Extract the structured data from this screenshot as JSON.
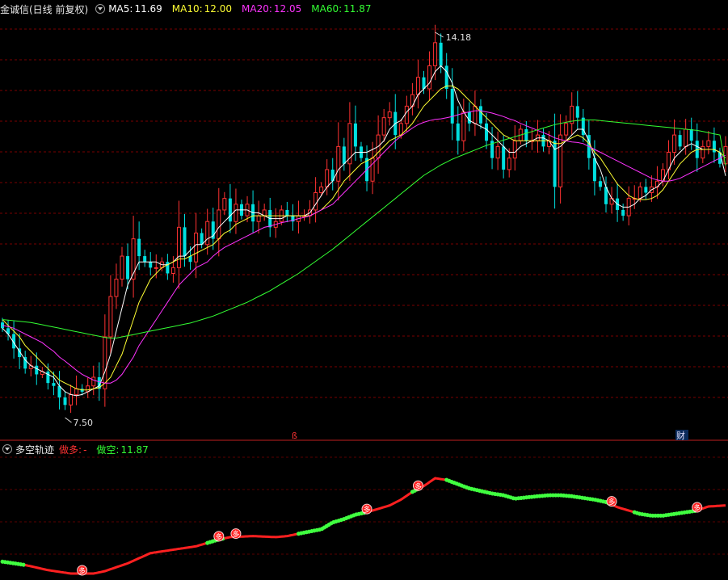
{
  "header": {
    "stock_title": "金诚信(日线 前复权)",
    "ma_legend": [
      {
        "label": "MA5:",
        "value": "11.69",
        "color": "#ffffff"
      },
      {
        "label": "MA10:",
        "value": "12.00",
        "color": "#ffff33"
      },
      {
        "label": "MA20:",
        "value": "12.05",
        "color": "#ff33ff"
      },
      {
        "label": "MA60:",
        "value": "11.87",
        "color": "#33ff33"
      }
    ]
  },
  "sub_header": {
    "title": "多空轨迹",
    "long_label": "做多:",
    "long_value": "-",
    "short_label": "做空:",
    "short_value": "11.87"
  },
  "markers": {
    "date_marker": "ß",
    "finance_marker": "财",
    "signal_label": "多"
  },
  "colors": {
    "background": "#000000",
    "grid": "#7a0000",
    "up": "#ff3232",
    "down": "#00e0e0",
    "ma5": "#ffffff",
    "ma10": "#ffff33",
    "ma20": "#ff33ff",
    "ma60": "#33ff33",
    "trend_long": "#ff2020",
    "trend_short": "#40ff40"
  },
  "chart_data": [
    {
      "type": "candlestick",
      "ylim": [
        7.2,
        14.7
      ],
      "max_label": "14.18",
      "min_label": "7.50",
      "max_point": [
        76,
        14.18
      ],
      "min_point": [
        11,
        7.5
      ],
      "close": [
        9.05,
        8.95,
        8.7,
        8.55,
        8.35,
        8.4,
        8.25,
        8.3,
        8.1,
        8.05,
        7.85,
        7.72,
        7.9,
        8.0,
        7.95,
        8.05,
        8.2,
        8.0,
        8.9,
        9.6,
        9.9,
        10.3,
        9.9,
        10.6,
        10.3,
        10.2,
        10.1,
        10.1,
        10.2,
        10.0,
        10.1,
        10.8,
        10.3,
        10.2,
        10.7,
        10.5,
        10.9,
        10.6,
        11.1,
        11.3,
        10.9,
        11.2,
        11.0,
        11.2,
        10.9,
        11.0,
        11.1,
        10.8,
        10.9,
        11.1,
        11.0,
        10.9,
        11.0,
        11.0,
        11.1,
        11.4,
        11.5,
        11.8,
        11.6,
        12.2,
        11.9,
        12.6,
        12.2,
        12.0,
        11.6,
        12.0,
        12.4,
        12.7,
        12.8,
        12.4,
        12.6,
        12.9,
        13.1,
        13.4,
        13.2,
        13.6,
        14.0,
        13.6,
        13.2,
        12.6,
        12.3,
        12.8,
        12.6,
        12.9,
        12.6,
        12.3,
        12.0,
        12.2,
        11.8,
        12.0,
        12.3,
        12.5,
        12.3,
        12.3,
        12.4,
        12.2,
        12.3,
        11.5,
        12.4,
        12.6,
        12.9,
        12.7,
        12.4,
        12.0,
        11.6,
        11.5,
        11.2,
        11.3,
        11.1,
        11.0,
        11.3,
        11.3,
        11.5,
        11.4,
        11.5,
        11.6,
        11.8,
        12.1,
        12.4,
        12.2,
        12.5,
        12.3,
        12.0,
        12.2,
        12.3,
        12.1,
        11.9,
        12.2
      ]
    },
    {
      "type": "line",
      "series": [
        {
          "name": "MA5",
          "values": [
            9.05,
            8.95,
            8.8,
            8.65,
            8.5,
            8.4,
            8.35,
            8.3,
            8.25,
            8.2,
            8.05,
            7.95,
            7.9,
            7.88,
            7.9,
            7.95,
            8.0,
            8.05,
            8.3,
            8.6,
            9.0,
            9.4,
            9.8,
            10.0,
            10.2,
            10.2,
            10.2,
            10.2,
            10.15,
            10.15,
            10.2,
            10.3,
            10.3,
            10.4,
            10.5,
            10.5,
            10.6,
            10.65,
            10.8,
            10.9,
            11.0,
            11.1,
            11.1,
            11.1,
            11.05,
            11.05,
            11.0,
            10.95,
            10.95,
            10.95,
            11.0,
            11.0,
            11.0,
            11.0,
            11.05,
            11.2,
            11.35,
            11.5,
            11.6,
            11.8,
            11.9,
            12.0,
            12.1,
            12.1,
            12.1,
            12.15,
            12.2,
            12.3,
            12.5,
            12.6,
            12.65,
            12.8,
            12.9,
            13.1,
            13.2,
            13.3,
            13.5,
            13.6,
            13.5,
            13.3,
            13.0,
            12.8,
            12.65,
            12.6,
            12.55,
            12.5,
            12.4,
            12.3,
            12.2,
            12.1,
            12.1,
            12.2,
            12.25,
            12.3,
            12.35,
            12.35,
            12.3,
            12.15,
            12.2,
            12.3,
            12.4,
            12.5,
            12.5,
            12.3,
            12.0,
            11.8,
            11.5,
            11.3,
            11.2,
            11.15,
            11.15,
            11.2,
            11.3,
            11.35,
            11.45,
            11.5,
            11.6,
            11.8,
            12.0,
            12.1,
            12.2,
            12.25,
            12.2,
            12.15,
            12.15,
            12.15,
            12.1,
            11.69
          ]
        },
        {
          "name": "MA10",
          "values": [
            9.2,
            9.1,
            9.0,
            8.9,
            8.75,
            8.65,
            8.55,
            8.45,
            8.35,
            8.25,
            8.15,
            8.1,
            8.05,
            8.0,
            7.98,
            7.98,
            8.0,
            8.02,
            8.1,
            8.2,
            8.4,
            8.6,
            8.9,
            9.2,
            9.5,
            9.7,
            9.9,
            10.0,
            10.1,
            10.15,
            10.2,
            10.25,
            10.25,
            10.3,
            10.35,
            10.4,
            10.45,
            10.5,
            10.6,
            10.7,
            10.75,
            10.85,
            10.9,
            10.95,
            11.0,
            11.0,
            11.0,
            11.0,
            11.0,
            11.0,
            11.0,
            11.0,
            11.0,
            11.0,
            11.0,
            11.05,
            11.1,
            11.2,
            11.3,
            11.45,
            11.6,
            11.7,
            11.8,
            11.9,
            11.95,
            12.0,
            12.1,
            12.2,
            12.3,
            12.35,
            12.4,
            12.5,
            12.6,
            12.75,
            12.9,
            13.0,
            13.1,
            13.2,
            13.25,
            13.25,
            13.2,
            13.1,
            13.0,
            12.9,
            12.8,
            12.7,
            12.6,
            12.5,
            12.4,
            12.35,
            12.3,
            12.3,
            12.3,
            12.3,
            12.3,
            12.3,
            12.3,
            12.25,
            12.25,
            12.3,
            12.35,
            12.4,
            12.35,
            12.25,
            12.1,
            12.0,
            11.85,
            11.7,
            11.55,
            11.45,
            11.35,
            11.3,
            11.28,
            11.28,
            11.3,
            11.35,
            11.45,
            11.6,
            11.75,
            11.9,
            12.0,
            12.1,
            12.15,
            12.15,
            12.15,
            12.15,
            12.1,
            12.0
          ]
        },
        {
          "name": "MA20",
          "values": [
            9.1,
            9.08,
            9.05,
            9.0,
            8.95,
            8.9,
            8.85,
            8.8,
            8.72,
            8.65,
            8.55,
            8.48,
            8.4,
            8.32,
            8.25,
            8.2,
            8.15,
            8.12,
            8.1,
            8.1,
            8.15,
            8.25,
            8.4,
            8.55,
            8.75,
            8.9,
            9.05,
            9.2,
            9.35,
            9.5,
            9.65,
            9.8,
            9.9,
            10.0,
            10.1,
            10.15,
            10.2,
            10.3,
            10.38,
            10.45,
            10.5,
            10.55,
            10.6,
            10.65,
            10.7,
            10.75,
            10.8,
            10.82,
            10.85,
            10.88,
            10.9,
            10.92,
            10.95,
            10.97,
            11.0,
            11.05,
            11.1,
            11.15,
            11.2,
            11.3,
            11.4,
            11.5,
            11.6,
            11.7,
            11.8,
            11.9,
            12.0,
            12.1,
            12.2,
            12.3,
            12.38,
            12.45,
            12.52,
            12.58,
            12.62,
            12.65,
            12.67,
            12.68,
            12.7,
            12.72,
            12.75,
            12.78,
            12.8,
            12.82,
            12.82,
            12.8,
            12.78,
            12.75,
            12.72,
            12.68,
            12.65,
            12.6,
            12.56,
            12.52,
            12.48,
            12.44,
            12.4,
            12.35,
            12.32,
            12.3,
            12.28,
            12.27,
            12.25,
            12.2,
            12.15,
            12.1,
            12.05,
            12.0,
            11.95,
            11.9,
            11.85,
            11.8,
            11.75,
            11.7,
            11.65,
            11.62,
            11.6,
            11.6,
            11.62,
            11.65,
            11.7,
            11.75,
            11.8,
            11.85,
            11.9,
            11.95,
            12.0,
            12.05
          ]
        },
        {
          "name": "MA60",
          "values": [
            9.2,
            9.19,
            9.18,
            9.17,
            9.16,
            9.15,
            9.13,
            9.11,
            9.09,
            9.07,
            9.05,
            9.03,
            9.01,
            8.99,
            8.97,
            8.95,
            8.93,
            8.91,
            8.89,
            8.88,
            8.88,
            8.9,
            8.92,
            8.94,
            8.96,
            8.98,
            9.0,
            9.02,
            9.04,
            9.06,
            9.08,
            9.1,
            9.12,
            9.14,
            9.17,
            9.2,
            9.23,
            9.26,
            9.3,
            9.34,
            9.38,
            9.42,
            9.46,
            9.5,
            9.55,
            9.6,
            9.65,
            9.7,
            9.76,
            9.82,
            9.88,
            9.94,
            10.0,
            10.07,
            10.14,
            10.21,
            10.28,
            10.35,
            10.42,
            10.5,
            10.58,
            10.66,
            10.74,
            10.82,
            10.9,
            10.98,
            11.06,
            11.14,
            11.22,
            11.3,
            11.38,
            11.46,
            11.54,
            11.62,
            11.7,
            11.76,
            11.82,
            11.88,
            11.93,
            11.98,
            12.02,
            12.06,
            12.1,
            12.14,
            12.18,
            12.22,
            12.25,
            12.28,
            12.31,
            12.34,
            12.37,
            12.4,
            12.43,
            12.46,
            12.49,
            12.52,
            12.55,
            12.58,
            12.6,
            12.62,
            12.64,
            12.65,
            12.66,
            12.66,
            12.66,
            12.65,
            12.64,
            12.63,
            12.62,
            12.61,
            12.6,
            12.59,
            12.58,
            12.57,
            12.56,
            12.55,
            12.54,
            12.53,
            12.52,
            12.51,
            12.5,
            12.49,
            12.48,
            12.46,
            12.44,
            12.42,
            12.4,
            11.87
          ]
        }
      ]
    },
    {
      "type": "line",
      "title": "多空轨迹",
      "x": [
        0,
        4,
        8,
        12,
        16,
        18,
        22,
        26,
        30,
        34,
        36,
        38,
        40,
        44,
        48,
        50,
        52,
        56,
        58,
        60,
        62,
        64,
        68,
        70,
        72,
        74,
        76,
        78,
        82,
        86,
        88,
        90,
        94,
        96,
        98,
        100,
        104,
        106,
        108,
        110,
        112,
        114,
        116,
        118,
        122,
        124,
        127
      ],
      "values": [
        7.9,
        7.8,
        7.65,
        7.55,
        7.55,
        7.62,
        7.85,
        8.15,
        8.25,
        8.35,
        8.45,
        8.55,
        8.62,
        8.65,
        8.62,
        8.65,
        8.72,
        8.85,
        9.05,
        9.15,
        9.28,
        9.35,
        9.55,
        9.72,
        9.95,
        10.12,
        10.35,
        10.3,
        10.05,
        9.9,
        9.85,
        9.75,
        9.82,
        9.85,
        9.85,
        9.82,
        9.72,
        9.65,
        9.5,
        9.4,
        9.3,
        9.25,
        9.25,
        9.3,
        9.4,
        9.52,
        9.55
      ],
      "segments": [
        {
          "from": 0,
          "to": 4,
          "state": "short"
        },
        {
          "from": 4,
          "to": 36,
          "state": "long"
        },
        {
          "from": 36,
          "to": 39,
          "state": "short"
        },
        {
          "from": 39,
          "to": 52,
          "state": "long"
        },
        {
          "from": 52,
          "to": 64,
          "state": "short"
        },
        {
          "from": 64,
          "to": 72,
          "state": "long"
        },
        {
          "from": 72,
          "to": 73,
          "state": "short"
        },
        {
          "from": 73,
          "to": 78,
          "state": "long"
        },
        {
          "from": 78,
          "to": 107,
          "state": "short"
        },
        {
          "from": 107,
          "to": 111,
          "state": "long"
        },
        {
          "from": 111,
          "to": 122,
          "state": "short"
        },
        {
          "from": 122,
          "to": 127,
          "state": "long"
        }
      ],
      "signals": [
        14,
        38,
        41,
        64,
        73,
        107,
        122
      ]
    }
  ]
}
